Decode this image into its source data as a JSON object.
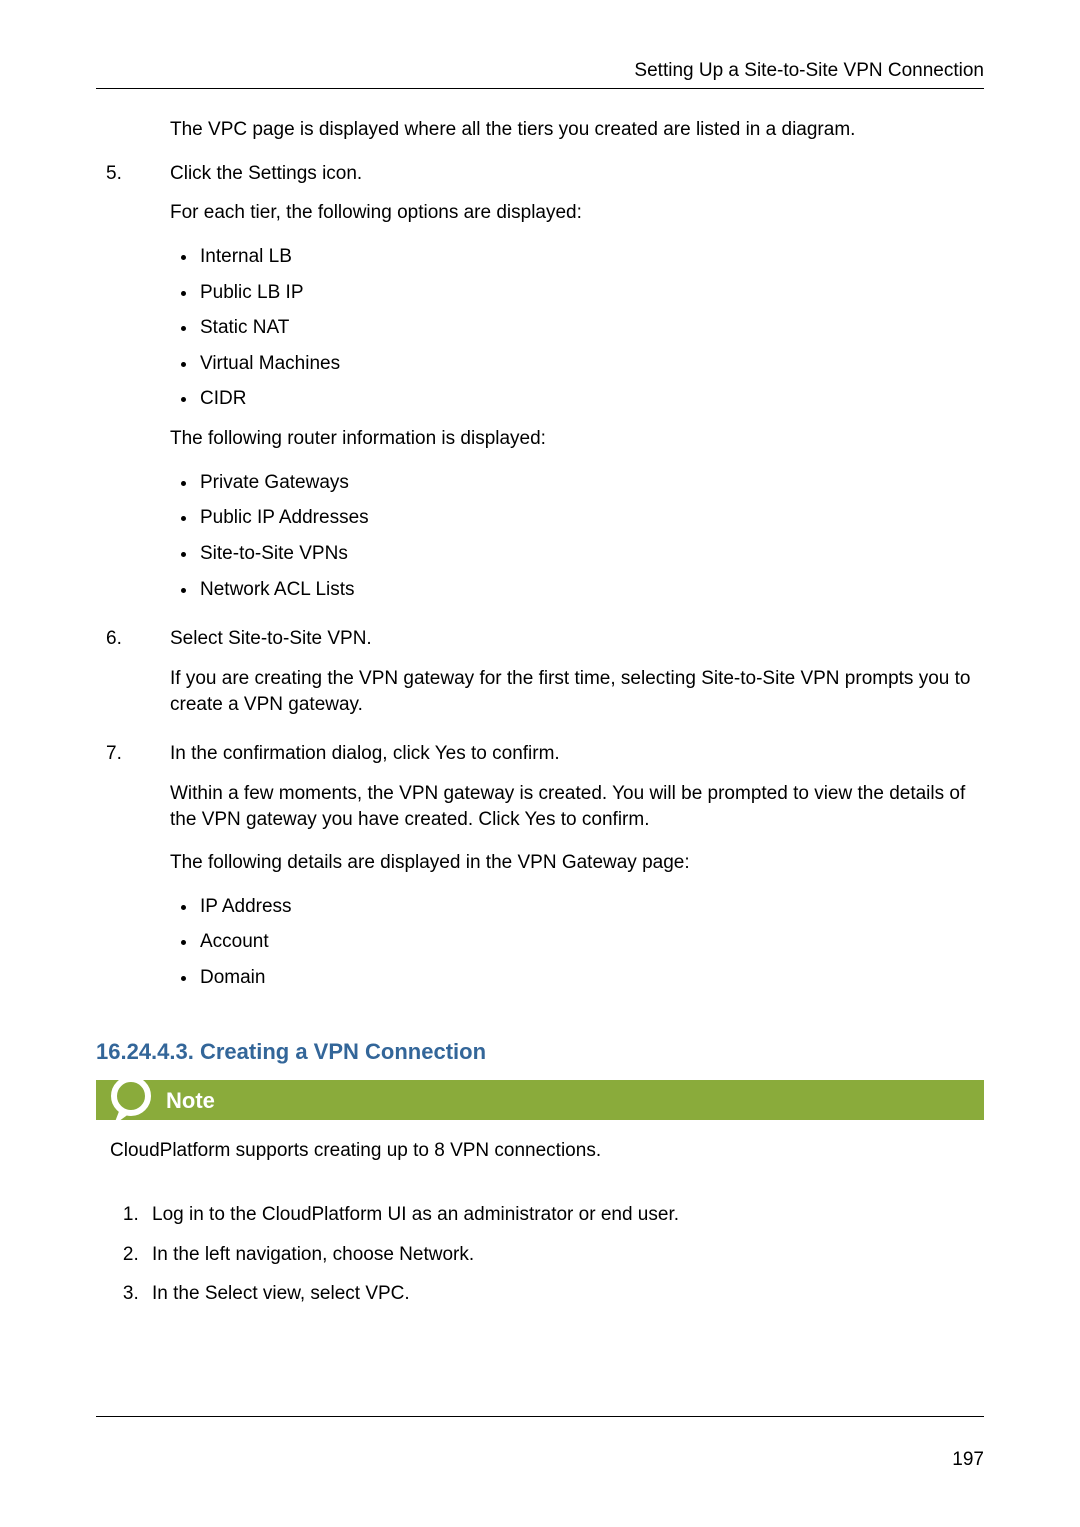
{
  "header": {
    "running_title": "Setting Up a Site-to-Site VPN Connection"
  },
  "pre_step_paragraph": "The VPC page is displayed where all the tiers you created are listed in a diagram.",
  "steps_a": [
    {
      "num": "5.",
      "lead": "Click the Settings icon.",
      "paras": [
        "For each tier, the following options are displayed:"
      ],
      "bullets": [
        "Internal LB",
        "Public LB IP",
        "Static NAT",
        "Virtual Machines",
        "CIDR"
      ],
      "paras2": [
        "The following router information is displayed:"
      ],
      "bullets2": [
        "Private Gateways",
        "Public IP Addresses",
        "Site-to-Site VPNs",
        "Network ACL Lists"
      ]
    },
    {
      "num": "6.",
      "lead": "Select Site-to-Site VPN.",
      "paras": [
        "If you are creating the VPN gateway for the first time, selecting Site-to-Site VPN prompts you to create a VPN gateway."
      ]
    },
    {
      "num": "7.",
      "lead": "In the confirmation dialog, click Yes to confirm.",
      "paras": [
        "Within a few moments, the VPN gateway is created. You will be prompted to view the details of the VPN gateway you have created. Click Yes to confirm.",
        "The following details are displayed in the VPN Gateway page:"
      ],
      "bullets": [
        "IP Address",
        "Account",
        "Domain"
      ]
    }
  ],
  "subheading": "16.24.4.3. Creating a VPN Connection",
  "note": {
    "label": "Note",
    "body": "CloudPlatform supports creating up to 8 VPN connections."
  },
  "steps_b": [
    {
      "lead": "Log in to the CloudPlatform UI as an administrator or end user."
    },
    {
      "lead": "In the left navigation, choose Network."
    },
    {
      "lead": "In the Select view, select VPC."
    }
  ],
  "page_number": "197"
}
